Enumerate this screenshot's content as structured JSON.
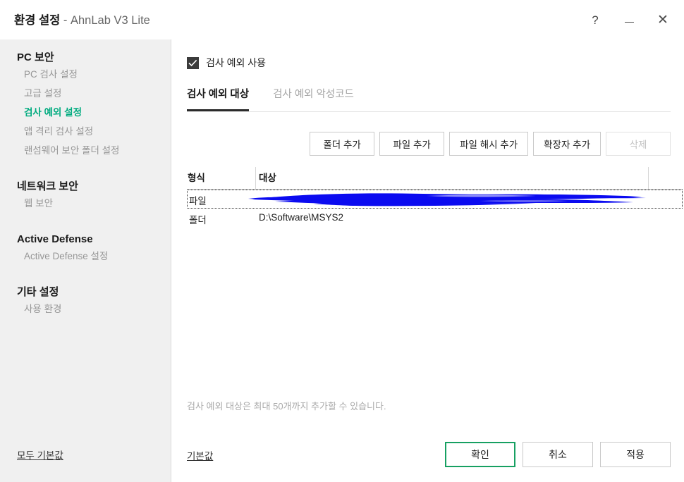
{
  "window": {
    "title_strong": "환경 설정",
    "title_sep": " - ",
    "title_rest": "AhnLab V3 Lite",
    "controls": {
      "help": "?",
      "minimize": "",
      "close": "✕"
    }
  },
  "sidebar": {
    "groups": [
      {
        "title": "PC 보안",
        "items": [
          {
            "label": "PC 검사 설정",
            "active": false
          },
          {
            "label": "고급 설정",
            "active": false
          },
          {
            "label": "검사 예외 설정",
            "active": true
          },
          {
            "label": "앱 격리 검사 설정",
            "active": false
          },
          {
            "label": "랜섬웨어 보안 폴더 설정",
            "active": false
          }
        ]
      },
      {
        "title": "네트워크 보안",
        "items": [
          {
            "label": "웹 보안",
            "active": false
          }
        ]
      },
      {
        "title": "Active Defense",
        "items": [
          {
            "label": "Active Defense 설정",
            "active": false
          }
        ]
      },
      {
        "title": "기타 설정",
        "items": [
          {
            "label": "사용 환경",
            "active": false
          }
        ]
      }
    ],
    "reset_all_label": "모두 기본값"
  },
  "main": {
    "enable_checkbox": {
      "label": "검사 예외 사용",
      "checked": true
    },
    "tabs": [
      {
        "label": "검사 예외 대상",
        "active": true
      },
      {
        "label": "검사 예외 악성코드",
        "active": false
      }
    ],
    "actions": [
      {
        "label": "폴더 추가",
        "disabled": false
      },
      {
        "label": "파일 추가",
        "disabled": false
      },
      {
        "label": "파일 해시 추가",
        "disabled": false
      },
      {
        "label": "확장자 추가",
        "disabled": false
      },
      {
        "label": "삭제",
        "disabled": true
      }
    ],
    "table": {
      "columns": [
        "형식",
        "대상"
      ],
      "rows": [
        {
          "type": "파일",
          "target": "",
          "redacted": true,
          "selected": true
        },
        {
          "type": "폴더",
          "target": "D:\\Software\\MSYS2",
          "redacted": false,
          "selected": false
        }
      ]
    },
    "note": "검사 예외 대상은 최대 50개까지 추가할 수 있습니다.",
    "footer": {
      "default_link": "기본값",
      "buttons": [
        {
          "label": "확인",
          "primary": true
        },
        {
          "label": "취소",
          "primary": false
        },
        {
          "label": "적용",
          "primary": false
        }
      ]
    }
  },
  "colors": {
    "accent_green": "#00ab7f",
    "primary_border": "#17a062",
    "redaction": "#0b0bf0",
    "sidebar_bg": "#f0f0f0"
  }
}
